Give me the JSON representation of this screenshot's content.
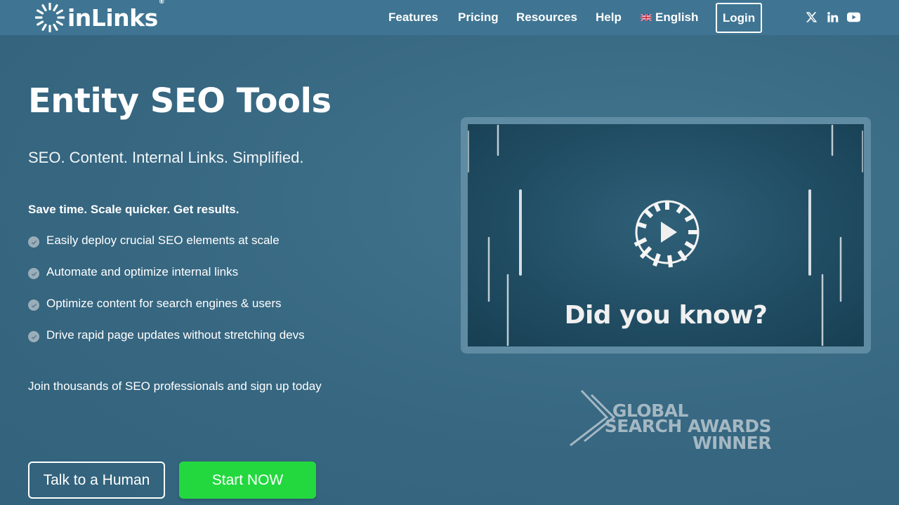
{
  "header": {
    "logo_text": "inLinks",
    "logo_reg": "®",
    "nav": [
      {
        "label": "Features"
      },
      {
        "label": "Pricing"
      },
      {
        "label": "Resources"
      },
      {
        "label": "Help"
      },
      {
        "label": "English"
      }
    ],
    "login_label": "Login",
    "social_icons": [
      "x-icon",
      "linkedin-icon",
      "youtube-icon"
    ]
  },
  "hero": {
    "title": "Entity SEO Tools",
    "subtitle": "SEO. Content. Internal Links. Simplified.",
    "tagline": "Save time. Scale quicker. Get results.",
    "features": [
      "Easily deploy crucial SEO elements at scale",
      "Automate and optimize internal links",
      "Optimize content for search engines & users",
      "Drive rapid page updates without stretching devs"
    ],
    "join_text": "Join thousands of SEO professionals and sign up today",
    "btn_human": "Talk to a Human",
    "btn_start": "Start NOW"
  },
  "video": {
    "caption": "Did you know?"
  },
  "award": {
    "line1": "GLOBAL",
    "line2": "SEARCH AWARDS",
    "line3": "WINNER"
  },
  "colors": {
    "background": "#3a6b85",
    "header": "#3f7593",
    "cta_green": "#22d83e",
    "award_grey": "#a4b8c3"
  }
}
